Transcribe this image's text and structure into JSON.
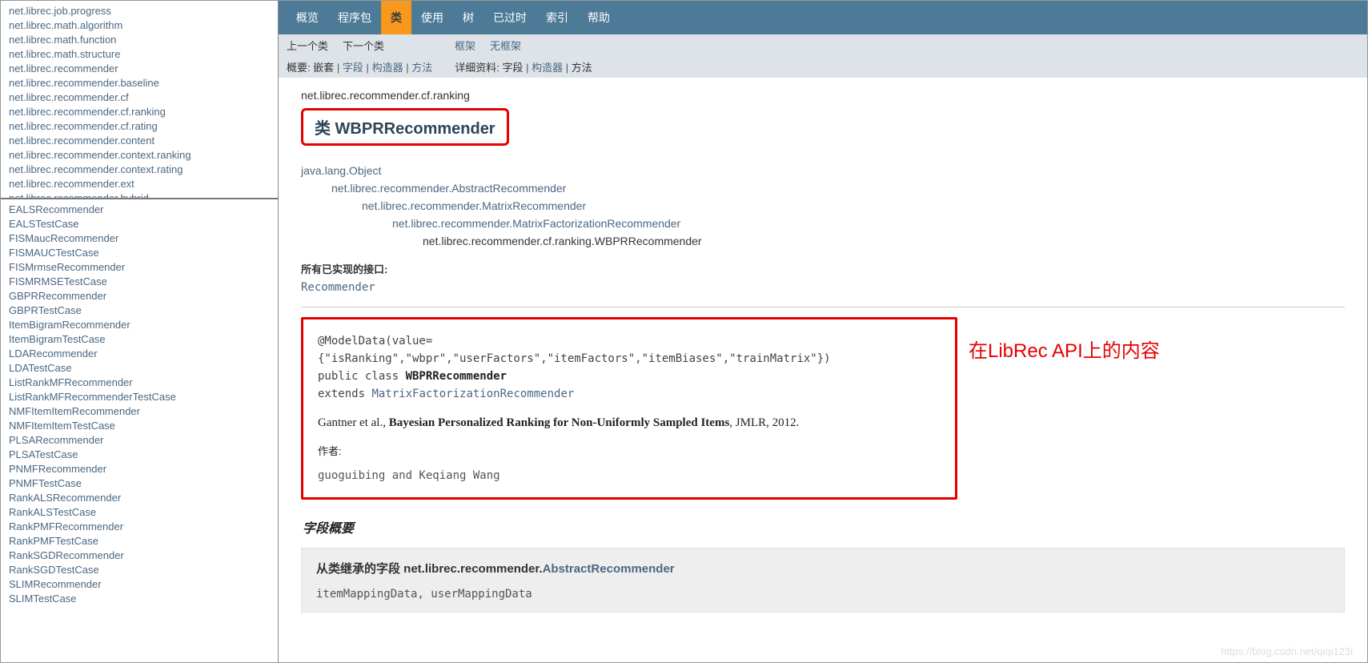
{
  "left": {
    "packages": [
      "net.librec.job.progress",
      "net.librec.math.algorithm",
      "net.librec.math.function",
      "net.librec.math.structure",
      "net.librec.recommender",
      "net.librec.recommender.baseline",
      "net.librec.recommender.cf",
      "net.librec.recommender.cf.ranking",
      "net.librec.recommender.cf.rating",
      "net.librec.recommender.content",
      "net.librec.recommender.context.ranking",
      "net.librec.recommender.context.rating",
      "net.librec.recommender.ext",
      "net.librec.recommender.hybrid"
    ],
    "classes": [
      "EALSRecommender",
      "EALSTestCase",
      "FISMaucRecommender",
      "FISMAUCTestCase",
      "FISMrmseRecommender",
      "FISMRMSETestCase",
      "GBPRRecommender",
      "GBPRTestCase",
      "ItemBigramRecommender",
      "ItemBigramTestCase",
      "LDARecommender",
      "LDATestCase",
      "ListRankMFRecommender",
      "ListRankMFRecommenderTestCase",
      "NMFItemItemRecommender",
      "NMFItemItemTestCase",
      "PLSARecommender",
      "PLSATestCase",
      "PNMFRecommender",
      "PNMFTestCase",
      "RankALSRecommender",
      "RankALSTestCase",
      "RankPMFRecommender",
      "RankPMFTestCase",
      "RankSGDRecommender",
      "RankSGDTestCase",
      "SLIMRecommender",
      "SLIMTestCase"
    ]
  },
  "topnav": {
    "overview": "概览",
    "packages": "程序包",
    "class_": "类",
    "use": "使用",
    "tree": "树",
    "deprecated": "已过时",
    "index": "索引",
    "help": "帮助"
  },
  "subnav": {
    "prev": "上一个类",
    "next": "下一个类",
    "frames": "框架",
    "noframes": "无框架"
  },
  "subnav2": {
    "summary_label": "概要:",
    "nested": "嵌套",
    "field": "字段",
    "constr": "构造器",
    "method": "方法",
    "detail_label": "详细资料:",
    "d_field": "字段",
    "d_constr": "构造器",
    "d_method": "方法"
  },
  "content": {
    "pkg": "net.librec.recommender.cf.ranking",
    "title": "类 WBPRRecommender",
    "hier": [
      "java.lang.Object",
      "net.librec.recommender.AbstractRecommender",
      "net.librec.recommender.MatrixRecommender",
      "net.librec.recommender.MatrixFactorizationRecommender",
      "net.librec.recommender.cf.ranking.WBPRRecommender"
    ],
    "iface_label": "所有已实现的接口:",
    "iface": "Recommender",
    "anno": "@ModelData(value={\"isRanking\",\"wbpr\",\"userFactors\",\"itemFactors\",\"itemBiases\",\"trainMatrix\"})",
    "decl_public": "public class ",
    "decl_name": "WBPRRecommender",
    "decl_ext1": "extends ",
    "decl_ext2": "MatrixFactorizationRecommender",
    "para_pre": "Gantner et al., ",
    "para_bold": "Bayesian Personalized Ranking for Non-Uniformly Sampled Items",
    "para_post": ", JMLR, 2012.",
    "author_label": "作者:",
    "author": "guoguibing and Keqiang Wang",
    "red_note": "在LibRec API上的内容",
    "section": "字段概要",
    "inh_pre": "从类继承的字段 net.librec.recommender.",
    "inh_link": "AbstractRecommender",
    "inh_fields": "itemMappingData, userMappingData",
    "watermark": "https://blog.csdn.net/qiqi123i"
  }
}
